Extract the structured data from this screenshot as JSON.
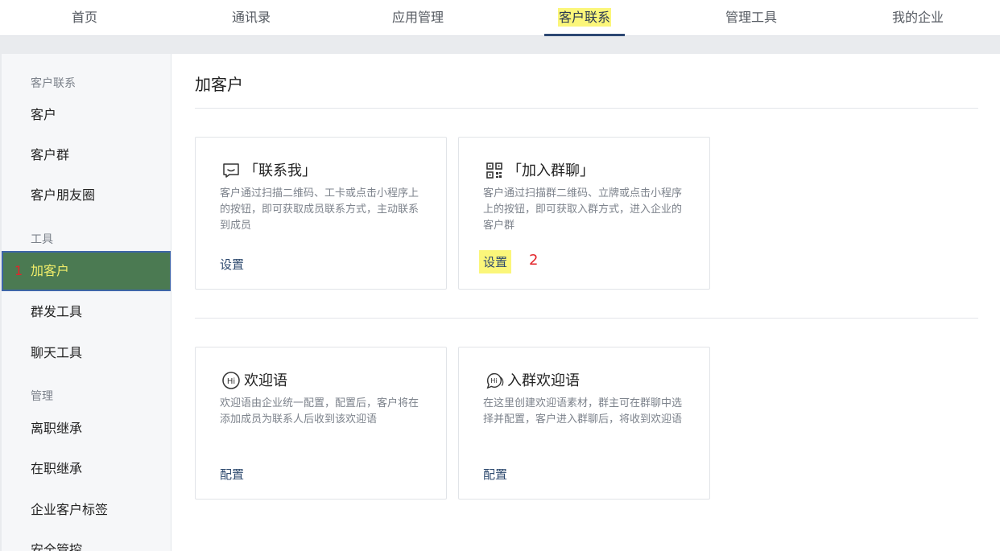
{
  "topnav": {
    "tabs": [
      {
        "label": "首页"
      },
      {
        "label": "通讯录"
      },
      {
        "label": "应用管理"
      },
      {
        "label": "客户联系"
      },
      {
        "label": "管理工具"
      },
      {
        "label": "我的企业"
      }
    ],
    "active_tab": "客户联系"
  },
  "sidebar": {
    "group_customer": "客户联系",
    "customer": "客户",
    "customer_group": "客户群",
    "moments": "客户朋友圈",
    "group_tools": "工具",
    "add_customer": "加客户",
    "add_customer_marker": "1",
    "mass_send": "群发工具",
    "chat_tools": "聊天工具",
    "group_manage": "管理",
    "resign_inherit": "离职继承",
    "onjob_inherit": "在职继承",
    "customer_tags": "企业客户标签",
    "security": "安全管控"
  },
  "main": {
    "title": "加客户",
    "cards": {
      "contact_me": {
        "icon": "chat-icon",
        "title": "「联系我」",
        "desc": "客户通过扫描二维码、工卡或点击小程序上的按钮，即可获取成员联系方式，主动联系到成员",
        "link": "设置"
      },
      "join_group": {
        "icon": "qrcode-icon",
        "title": "「加入群聊」",
        "desc": "客户通过扫描群二维码、立牌或点击小程序上的按钮，即可获取入群方式，进入企业的客户群",
        "link": "设置",
        "marker": "2"
      },
      "welcome": {
        "icon": "hi-icon",
        "title": "欢迎语",
        "desc": "欢迎语由企业统一配置，配置后，客户将在添加成员为联系人后收到该欢迎语",
        "link": "配置"
      },
      "group_welcome": {
        "icon": "hi-chat-icon",
        "title": "入群欢迎语",
        "desc": "在这里创建欢迎语素材，群主可在群聊中选择并配置，客户进入群聊后，将收到欢迎语",
        "link": "配置"
      }
    }
  },
  "colors": {
    "accent_nav": "#2d4873",
    "highlight": "#fbf67a",
    "active_side_bg": "#4b7a52",
    "marker_red": "#e3252b",
    "link": "#2e4a6f"
  }
}
